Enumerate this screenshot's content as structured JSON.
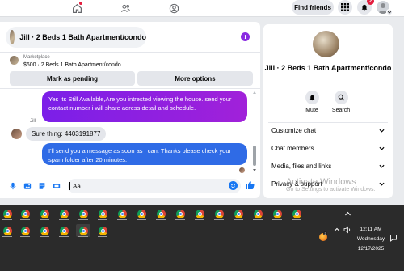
{
  "topbar": {
    "find_friends": "Find friends",
    "notification_count": "2"
  },
  "chat": {
    "header_title": "Jill · 2 Beds 1 Bath Apartment/condo",
    "marketplace_label": "Marketplace",
    "listing_line": "$600 · 2 Beds 1 Bath Apartment/condo",
    "mark_pending": "Mark as pending",
    "more_options": "More options",
    "messages": {
      "outgoing_1": "Yes Its Still Available,Are you intrested viewing the house. send your contact number i will share adress,detail and schedule.",
      "sender_name": "Jill",
      "incoming_1": "Sure thing: 4403191877",
      "outgoing_2": "I'll send you a message as soon as I can. Thanks please check your spam folder after 20 minutes."
    },
    "composer": {
      "value": "Aa"
    }
  },
  "info_panel": {
    "title": "Jill · 2 Beds 1 Bath Apartment/condo",
    "mute": "Mute",
    "search": "Search",
    "sections": [
      "Customize chat",
      "Chat members",
      "Media, files and links",
      "Privacy & support"
    ]
  },
  "watermark": {
    "line1": "Activate Windows",
    "line2": "Go to Settings to activate Windows."
  },
  "taskbar": {
    "time": "12:11 AM",
    "day": "Wednesday",
    "date": "12/17/2025",
    "app_badge": "2",
    "icons": [
      "chrome-icon"
    ]
  },
  "colors": {
    "messenger_blue": "#2f6be6",
    "messenger_purple": "#8a2be2",
    "facebook_blue": "#1877f2"
  }
}
